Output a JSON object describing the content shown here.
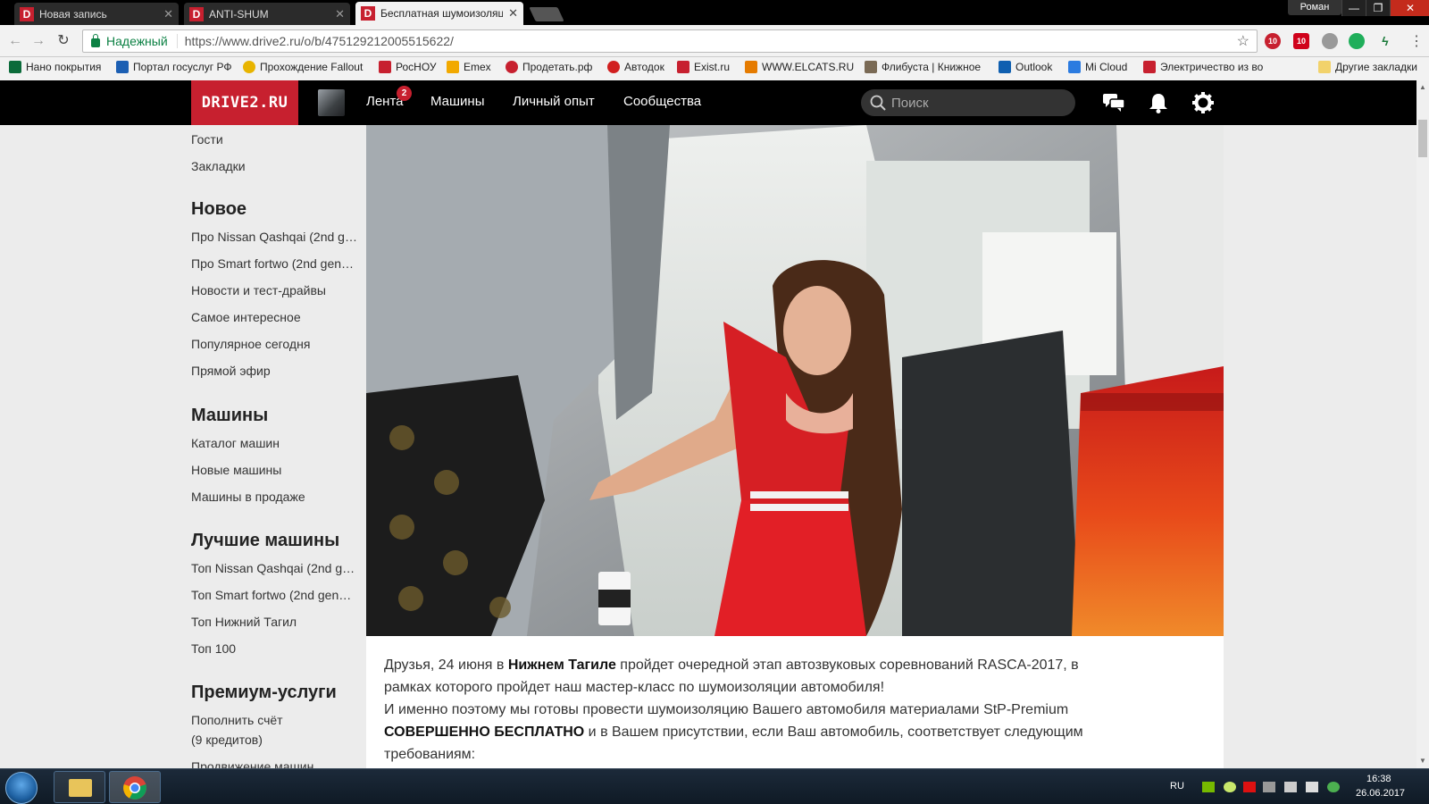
{
  "browser": {
    "tabs": [
      {
        "title": "Новая запись"
      },
      {
        "title": "ANTI-SHUM"
      },
      {
        "title": "Бесплатная шумоизоляция"
      }
    ],
    "profile": "Роман",
    "secure_label": "Надежный",
    "url": "https://www.drive2.ru/o/b/475129212005515622/",
    "extension_badges": [
      "10",
      "10"
    ],
    "bookmarks": [
      {
        "label": "Нано покрытия",
        "color": "#0b6b3a"
      },
      {
        "label": "Портал госуслуг РФ",
        "color": "#1c5fb3"
      },
      {
        "label": "Прохождение Fallout",
        "color": "#e8b400"
      },
      {
        "label": "РосНОУ",
        "color": "#c7202f"
      },
      {
        "label": "Emex",
        "color": "#f2a900"
      },
      {
        "label": "Продетать.рф",
        "color": "#c7202f"
      },
      {
        "label": "Автодок",
        "color": "#d11f1f"
      },
      {
        "label": "Exist.ru",
        "color": "#c7202f"
      },
      {
        "label": "WWW.ELCATS.RU -",
        "color": "#e57b00"
      },
      {
        "label": "Флибуста | Книжное",
        "color": "#7a6a55"
      },
      {
        "label": "Outlook",
        "color": "#0f5fb0"
      },
      {
        "label": "Mi Cloud",
        "color": "#2b7be0"
      },
      {
        "label": "Электричество из во",
        "color": "#c7202f"
      }
    ],
    "other_bookmarks": "Другие закладки"
  },
  "site": {
    "logo": "DRIVE2.RU",
    "nav": [
      "Лента",
      "Машины",
      "Личный опыт",
      "Сообщества"
    ],
    "feed_badge": "2",
    "search_placeholder": "Поиск"
  },
  "sidebar": {
    "top_links": [
      "Гости",
      "Закладки"
    ],
    "sections": [
      {
        "title": "Новое",
        "links": [
          "Про Nissan Qashqai (2nd g…",
          "Про Smart fortwo (2nd gen…",
          "Новости и тест-драйвы",
          "Самое интересное",
          "Популярное сегодня",
          "Прямой эфир"
        ]
      },
      {
        "title": "Машины",
        "links": [
          "Каталог машин",
          "Новые машины",
          "Машины в продаже"
        ]
      },
      {
        "title": "Лучшие машины",
        "links": [
          "Топ Nissan Qashqai (2nd g…",
          "Топ Smart fortwo (2nd gen…",
          "Топ Нижний Тагил",
          "Топ 100"
        ]
      },
      {
        "title": "Премиум-услуги",
        "links": [
          "Пополнить счёт",
          "(9 кредитов)",
          "Продвижение машин"
        ]
      }
    ]
  },
  "article": {
    "p1_a": "Друзья, 24 июня в ",
    "p1_bold": "Нижнем Тагиле",
    "p1_b": " пройдет очередной этап автозвуковых соревнований RASCA-2017, в рамках которого пройдет наш мастер-класс по шумоизоляции автомобиля!",
    "p2_a": "И именно поэтому мы готовы провести шумоизоляцию Вашего автомобиля материалами StP-Premium ",
    "p2_bold": "СОВЕРШЕННО БЕСПЛАТНО",
    "p2_b": " и в Вашем присутствии, если Ваш автомобиль, соответствует следующим требованиям:"
  },
  "taskbar": {
    "language": "RU",
    "time": "16:38",
    "date": "26.06.2017"
  }
}
